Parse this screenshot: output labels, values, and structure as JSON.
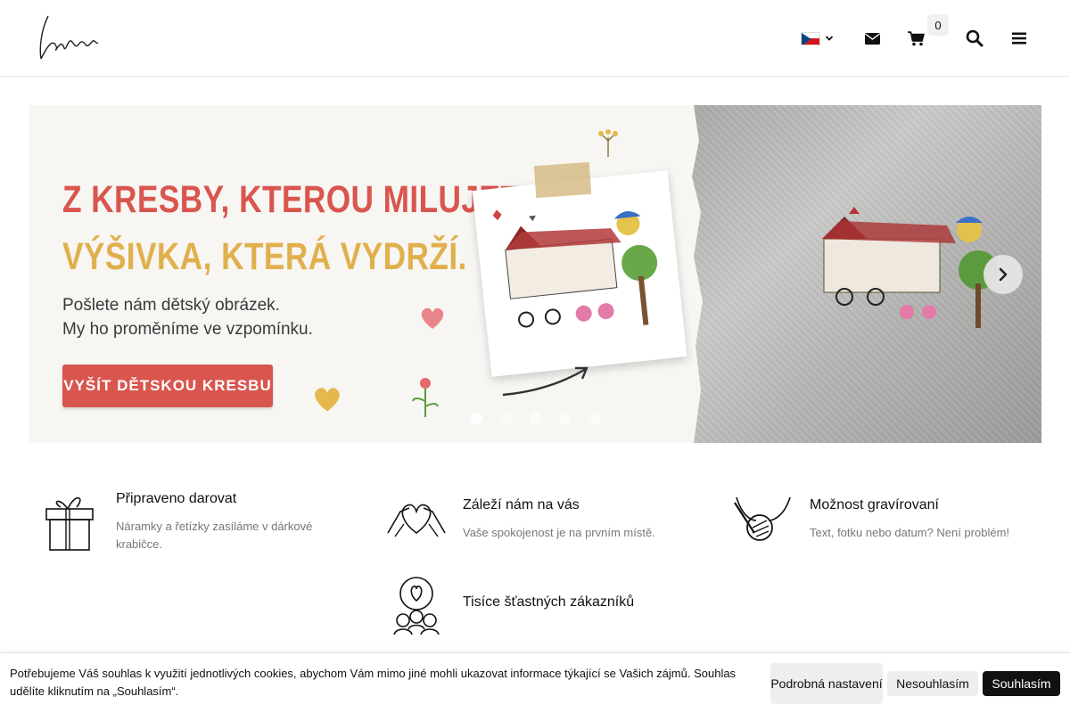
{
  "header": {
    "logo_text": "lovee",
    "language": "CZ",
    "cart_count": "0"
  },
  "banner": {
    "headline_line1": "Z KRESBY, KTEROU MILUJETE.",
    "headline_line2": "VÝŠIVKA, KTERÁ VYDRŽÍ.",
    "subtitle_line1": "Pošlete nám dětský obrázek.",
    "subtitle_line2": "My ho proměníme ve vzpomínku.",
    "cta_label": "VYŠÍT DĚTSKOU KRESBU",
    "slide_count": 5,
    "active_slide": 1,
    "colors": {
      "headline1": "#d9564e",
      "headline2": "#e0b04d",
      "cta": "#d9564e"
    }
  },
  "features": [
    {
      "icon": "gift-icon",
      "title": "Připraveno darovat",
      "desc": "Náramky a řetízky zasíláme v dárkové krabičce."
    },
    {
      "icon": "heart-hands-icon",
      "title": "Záleží nám na vás",
      "desc": "Vaše spokojenost je na prvním místě."
    },
    {
      "icon": "engraving-icon",
      "title": "Možnost gravírovaní",
      "desc": "Text, fotku nebo datum? Není problém!"
    },
    {
      "icon": "happy-customers-icon",
      "title": "Tisíce šťastných zákazníků",
      "desc": ""
    }
  ],
  "cookie": {
    "text": "Potřebujeme Váš souhlas k využití jednotlivých cookies, abychom Vám mimo jiné mohli ukazovat informace týkající se Vašich zájmů. Souhlas udělíte kliknutím na „Souhlasím“.",
    "detail_label": "Podrobná nastavení",
    "decline_label": "Nesouhlasím",
    "accept_label": "Souhlasím"
  }
}
